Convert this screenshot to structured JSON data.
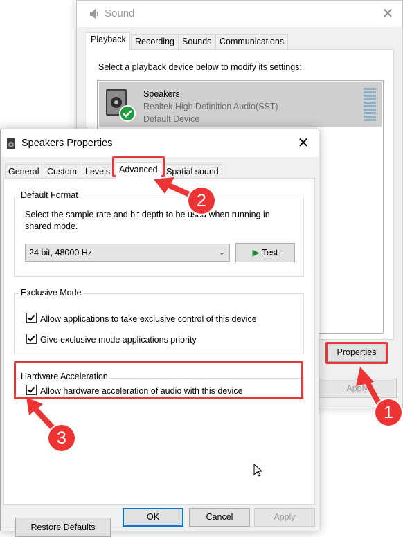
{
  "sound": {
    "title": "Sound",
    "tabs": [
      "Playback",
      "Recording",
      "Sounds",
      "Communications"
    ],
    "instruction": "Select a playback device below to modify its settings:",
    "device": {
      "name": "Speakers",
      "driver": "Realtek High Definition Audio(SST)",
      "status": "Default Device"
    },
    "properties_label": "Properties",
    "apply_label": "Apply"
  },
  "props": {
    "title": "Speakers Properties",
    "tabs": [
      "General",
      "Custom",
      "Levels",
      "Advanced",
      "Spatial sound"
    ],
    "default_format": {
      "title": "Default Format",
      "description": "Select the sample rate and bit depth to be used when running in shared mode.",
      "selected": "24 bit, 48000 Hz",
      "test_label": "Test"
    },
    "exclusive_mode": {
      "title": "Exclusive Mode",
      "allow_exclusive": "Allow applications to take exclusive control of this device",
      "give_priority": "Give exclusive mode applications priority"
    },
    "hardware_acceleration": {
      "title": "Hardware Acceleration",
      "allow_hw": "Allow hardware acceleration of audio with this device"
    },
    "restore_defaults_label": "Restore Defaults",
    "ok_label": "OK",
    "cancel_label": "Cancel",
    "apply_label": "Apply"
  },
  "annotations": {
    "step_1": "1",
    "step_2": "2",
    "step_3": "3",
    "color": "#e5383b"
  }
}
